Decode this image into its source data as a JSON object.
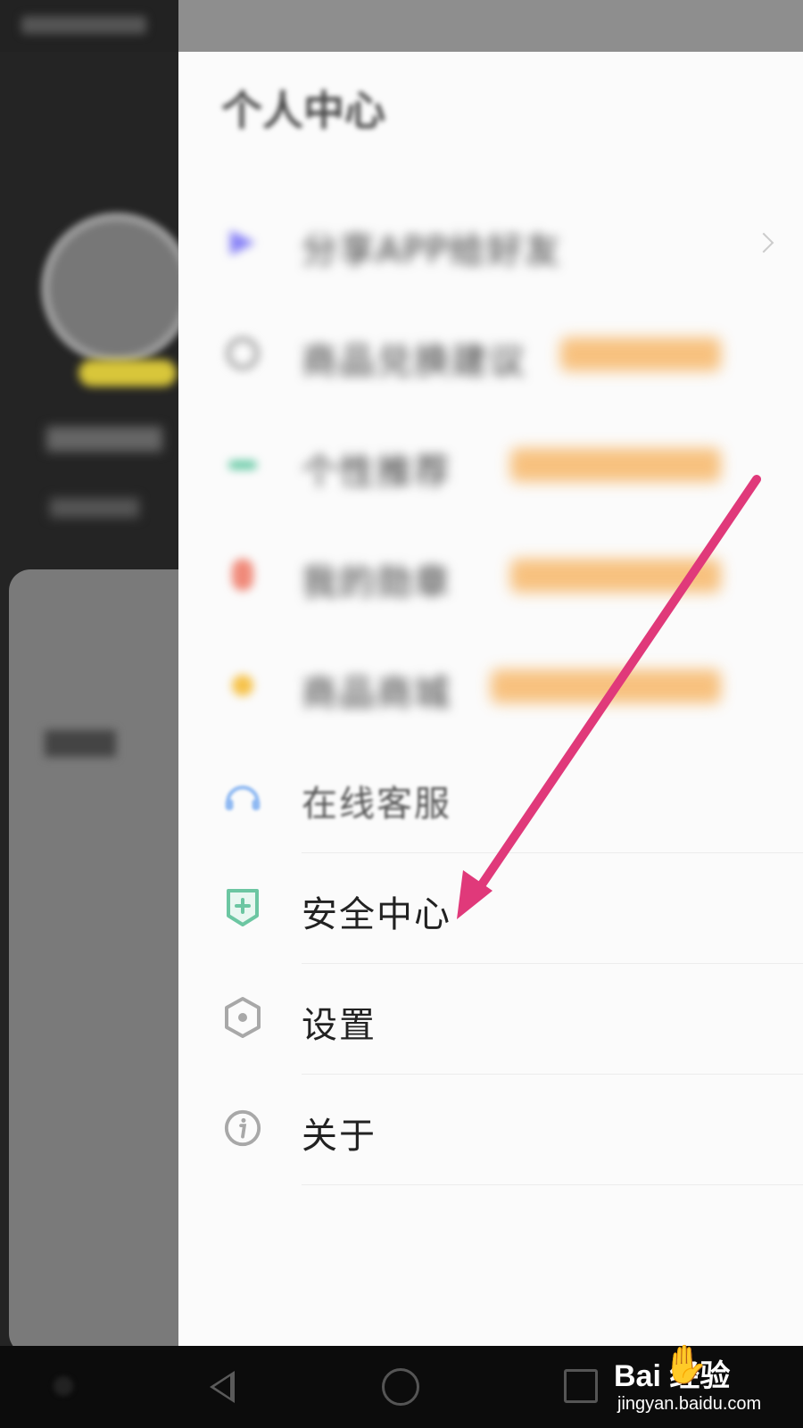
{
  "drawer": {
    "title": "个人中心",
    "items": [
      {
        "label": "分享APP给好友",
        "color": "#6a63f5"
      },
      {
        "label": "商品兑换建议",
        "color": "#999999"
      },
      {
        "label": "个性推荐",
        "color": "#64c9a4"
      },
      {
        "label": "我的勋章",
        "color": "#f08a7a"
      },
      {
        "label": "商品商城",
        "color": "#f6c24a"
      },
      {
        "label": "在线客服",
        "color": "#8fb9f2"
      },
      {
        "label": "安全中心",
        "color": "#6cc6a2"
      },
      {
        "label": "设置",
        "color": "#a8a8a8"
      },
      {
        "label": "关于",
        "color": "#a8a8a8"
      }
    ]
  },
  "annotation": {
    "arrow_color": "#e0397a"
  },
  "watermark": {
    "brand": "Bai  经验",
    "url": "jingyan.baidu.com"
  }
}
